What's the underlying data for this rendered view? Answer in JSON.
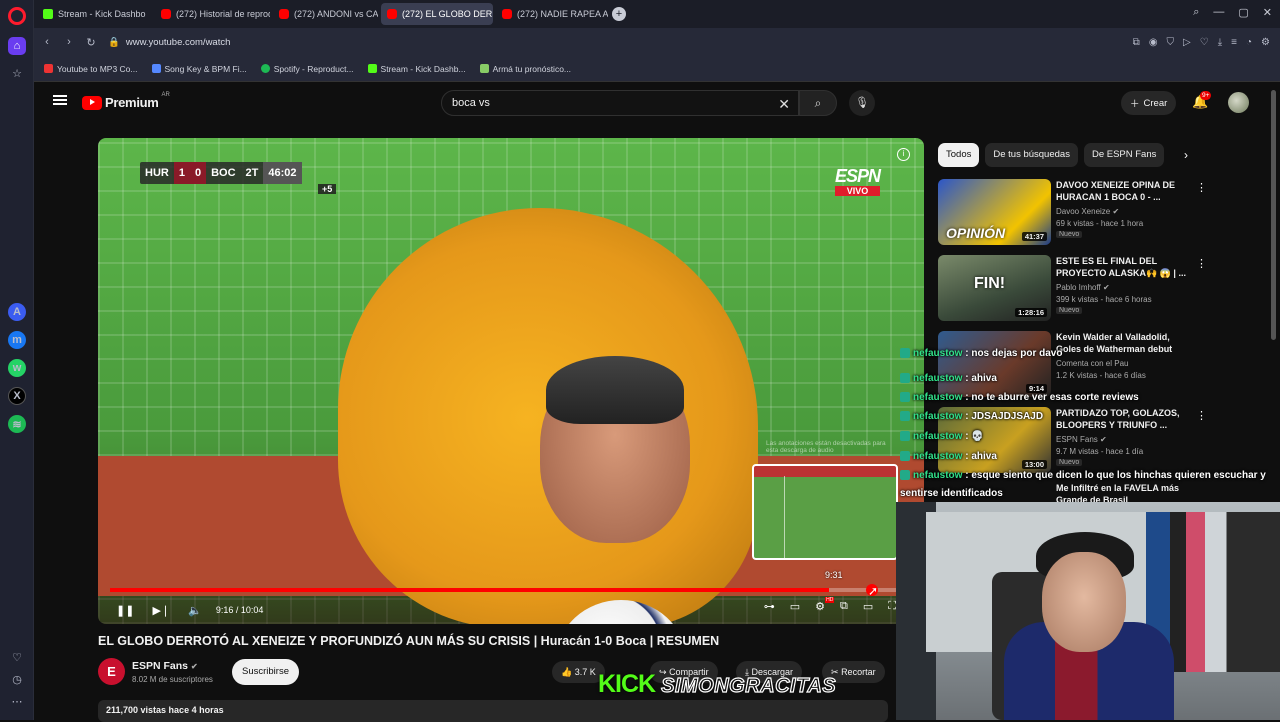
{
  "browser": {
    "tabs": [
      {
        "label": "Stream - Kick Dashbo",
        "favicon": "kick"
      },
      {
        "label": "(272) Historial de reprodu",
        "favicon": "yt"
      },
      {
        "label": "(272) ANDONI vs CARLOS",
        "favicon": "yt"
      },
      {
        "label": "(272) EL GLOBO DERR",
        "favicon": "yt",
        "active": true
      },
      {
        "label": "(272) NADIE RAPEA ASÍ",
        "favicon": "yt"
      }
    ],
    "url": "www.youtube.com/watch",
    "bookmarks": [
      {
        "label": "Youtube to MP3 Co..."
      },
      {
        "label": "Song Key & BPM Fi..."
      },
      {
        "label": "Spotify - Reproduct..."
      },
      {
        "label": "Stream - Kick Dashb..."
      },
      {
        "label": "Armá tu pronóstico..."
      }
    ]
  },
  "youtube": {
    "logo": "Premium",
    "country": "AR",
    "search_value": "boca vs",
    "create_label": "Crear",
    "notif_count": "9+"
  },
  "video": {
    "scorebug": {
      "home": "HUR",
      "home_score": "1",
      "away_score": "0",
      "away": "BOC",
      "half": "2T",
      "clock": "46:02",
      "added": "+5"
    },
    "network": "ESPN",
    "live_label": "VIVO",
    "hidden_text": "Las anotaciones están desactivadas para esta descarga de audio",
    "preview_time": "9:31",
    "time_current": "9:16",
    "time_total": "10:04",
    "progress": 0.91,
    "title": "EL GLOBO DERROTÓ AL XENEIZE Y PROFUNDIZÓ AUN MÁS SU CRISIS | Huracán 1-0 Boca | RESUMEN",
    "channel": "ESPN Fans",
    "subscribers": "8.02 M de suscriptores",
    "subscribe_label": "Suscribirse",
    "likes": "3.7 K",
    "share_label": "Compartir",
    "download_label": "Descargar",
    "clip_label": "Recortar",
    "views_line": "211,700 vistas  hace 4 horas"
  },
  "sidebar": {
    "chips": [
      "Todos",
      "De tus búsquedas",
      "De ESPN Fans"
    ],
    "items": [
      {
        "title": "DAVOO XENEIZE OPINA DE HURACAN 1 BOCA 0 - ...",
        "channel": "Davoo Xeneize",
        "meta": "69 k vistas - hace 1 hora",
        "badge": "Nuevo",
        "duration": "41:37",
        "thumb_text": "OPINIÓN"
      },
      {
        "title": "ESTE ES EL FINAL DEL PROYECTO ALASKA🙌 😱 | ...",
        "channel": "Pablo Imhoff",
        "meta": "399 k vistas - hace 6 horas",
        "badge": "Nuevo",
        "duration": "1:28:16",
        "thumb_text": "FIN!"
      },
      {
        "title": "Kevin Walder al Valladolid, Goles de Watherman debut de...",
        "channel": "Comenta con el Pau",
        "meta": "1.2 K vistas - hace 6 días",
        "badge": "",
        "duration": "9:14",
        "thumb_text": ""
      },
      {
        "title": "PARTIDAZO TOP, GOLAZOS, BLOOPERS Y TRIUNFO ...",
        "channel": "ESPN Fans",
        "meta": "9.7 M vistas - hace 1 día",
        "badge": "Nuevo",
        "duration": "13:00",
        "thumb_text": ""
      },
      {
        "title": "Me Infiltré en la FAVELA más Grande de Brasil",
        "channel": "",
        "meta": "",
        "badge": "",
        "duration": "",
        "thumb_text": ""
      }
    ]
  },
  "chat": [
    {
      "user": "nefaustow",
      "msg": "nos dejas por davo"
    },
    {
      "user": "nefaustow",
      "msg": "ahiva"
    },
    {
      "user": "nefaustow",
      "msg": "no te aburre ver esas corte reviews"
    },
    {
      "user": "nefaustow",
      "msg": "JDSAJDJSAJD"
    },
    {
      "user": "nefaustow",
      "msg": "💀"
    },
    {
      "user": "nefaustow",
      "msg": "ahiva"
    },
    {
      "user": "nefaustow",
      "msg": "esque siento que dicen lo que los hinchas quieren escuchar y"
    },
    {
      "user": "",
      "msg": "sentirse identificados"
    }
  ],
  "watermark": {
    "platform": "KICK",
    "user": "SIMONGRACITAS"
  }
}
